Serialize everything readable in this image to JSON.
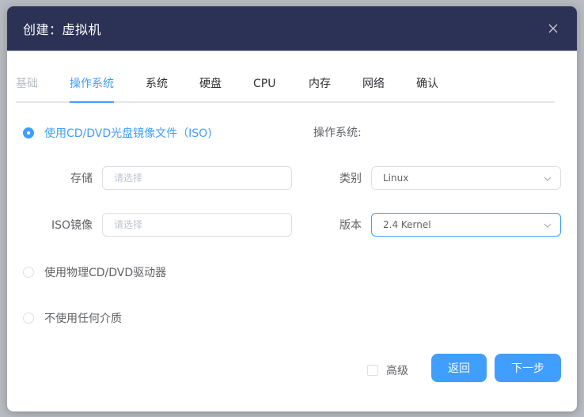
{
  "dialog": {
    "title": "创建：虚拟机",
    "close_icon": "close-icon"
  },
  "tabs": [
    {
      "label": "基础",
      "state": "disabled"
    },
    {
      "label": "操作系统",
      "state": "active"
    },
    {
      "label": "系统",
      "state": "normal"
    },
    {
      "label": "硬盘",
      "state": "normal"
    },
    {
      "label": "CPU",
      "state": "normal"
    },
    {
      "label": "内存",
      "state": "normal"
    },
    {
      "label": "网络",
      "state": "normal"
    },
    {
      "label": "确认",
      "state": "normal"
    }
  ],
  "media": {
    "iso_option": {
      "label": "使用CD/DVD光盘镜像文件（ISO)",
      "checked": true
    },
    "physical_option": {
      "label": "使用物理CD/DVD驱动器",
      "checked": false
    },
    "none_option": {
      "label": "不使用任何介质",
      "checked": false
    },
    "storage": {
      "label": "存储",
      "placeholder": "请选择",
      "value": ""
    },
    "iso_image": {
      "label": "ISO镜像",
      "placeholder": "请选择",
      "value": ""
    }
  },
  "os": {
    "heading": "操作系统:",
    "category": {
      "label": "类别",
      "value": "Linux"
    },
    "version": {
      "label": "版本",
      "value": "2.4 Kernel"
    }
  },
  "footer": {
    "advanced_label": "高级",
    "advanced_checked": false,
    "back_label": "返回",
    "next_label": "下一步"
  },
  "colors": {
    "header_bg": "#2b3256",
    "accent": "#409eff",
    "border": "#dcdfe6"
  }
}
